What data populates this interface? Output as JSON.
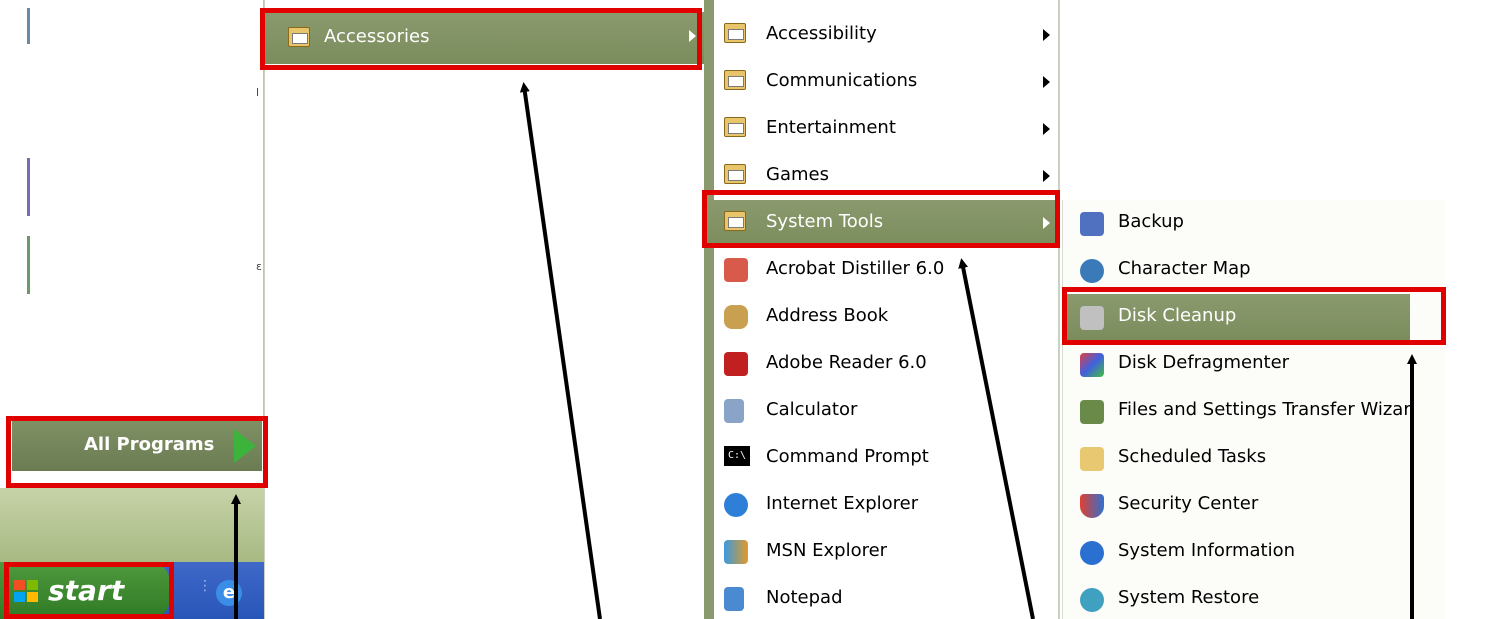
{
  "start_menu": {
    "all_programs_label": "All Programs"
  },
  "taskbar": {
    "start_label": "start",
    "quick_launch_ie_glyph": "e"
  },
  "programs_menu": {
    "accessories_label": "Accessories"
  },
  "accessories_menu": {
    "items": [
      {
        "label": "Accessibility",
        "icon": "folder-icon",
        "submenu": true
      },
      {
        "label": "Communications",
        "icon": "folder-icon",
        "submenu": true
      },
      {
        "label": "Entertainment",
        "icon": "folder-icon",
        "submenu": true
      },
      {
        "label": "Games",
        "icon": "folder-icon",
        "submenu": true
      },
      {
        "label": "System Tools",
        "icon": "folder-icon",
        "submenu": true,
        "highlighted": true
      },
      {
        "label": "Acrobat Distiller 6.0",
        "icon": "acrobat-distiller-icon"
      },
      {
        "label": "Address Book",
        "icon": "address-book-icon"
      },
      {
        "label": "Adobe Reader 6.0",
        "icon": "adobe-reader-icon"
      },
      {
        "label": "Calculator",
        "icon": "calculator-icon"
      },
      {
        "label": "Command Prompt",
        "icon": "command-prompt-icon",
        "glyph": "C:\\"
      },
      {
        "label": "Internet Explorer",
        "icon": "internet-explorer-icon"
      },
      {
        "label": "MSN Explorer",
        "icon": "msn-explorer-icon"
      },
      {
        "label": "Notepad",
        "icon": "notepad-icon"
      }
    ]
  },
  "system_tools_menu": {
    "items": [
      {
        "label": "Backup",
        "icon": "backup-icon"
      },
      {
        "label": "Character Map",
        "icon": "character-map-icon"
      },
      {
        "label": "Disk Cleanup",
        "icon": "disk-cleanup-icon",
        "highlighted": true
      },
      {
        "label": "Disk Defragmenter",
        "icon": "disk-defragmenter-icon"
      },
      {
        "label": "Files and Settings Transfer Wizard",
        "icon": "transfer-wizard-icon"
      },
      {
        "label": "Scheduled Tasks",
        "icon": "scheduled-tasks-icon"
      },
      {
        "label": "Security Center",
        "icon": "security-center-icon"
      },
      {
        "label": "System Information",
        "icon": "system-information-icon"
      },
      {
        "label": "System Restore",
        "icon": "system-restore-icon"
      }
    ]
  },
  "colors": {
    "menu_highlight": "#7b8c5c",
    "annotation_red": "#e00000",
    "start_green": "#2f7a25",
    "taskbar_blue": "#2856b8"
  }
}
